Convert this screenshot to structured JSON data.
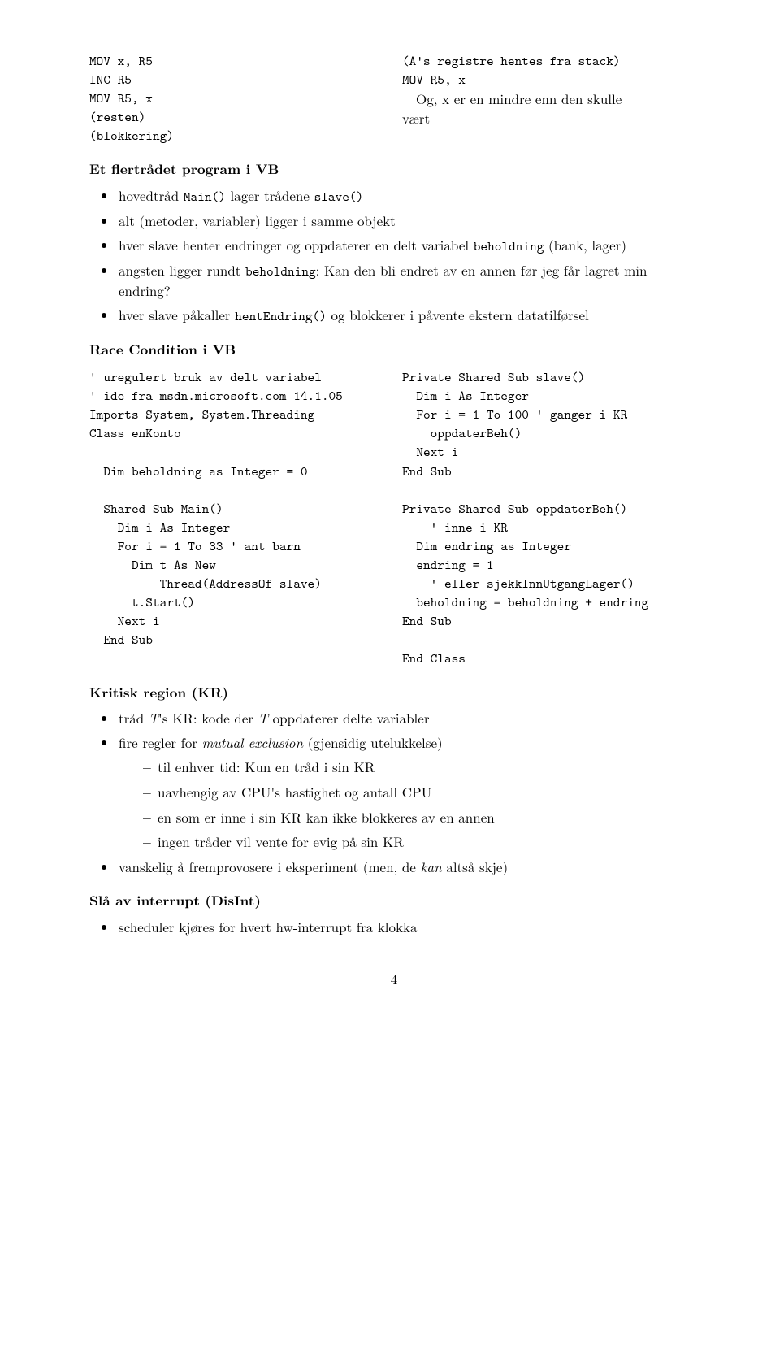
{
  "code1_left": "MOV x, R5\nINC R5\nMOV R5, x\n(resten)\n(blokkering)",
  "code1_right_l1": "(A's registre hentes fra stack)",
  "code1_right_l2": "MOV R5, x",
  "code1_right_prose_pre": "   Og, x er en mindre enn den skulle",
  "code1_right_prose_post": "vært",
  "sec1": "Et flertrådet program i VB",
  "b1_pre": "hovedtråd ",
  "b1_code1": "Main()",
  "b1_mid": " lager trådene ",
  "b1_code2": "slave()",
  "b2": "alt (metoder, variabler) ligger i samme objekt",
  "b3_pre": "hver slave henter endringer og oppdaterer en delt variabel ",
  "b3_code": "beholdning",
  "b3_post": " (bank, lager)",
  "b4_pre": "angsten ligger rundt ",
  "b4_code": "beholdning",
  "b4_post": ": Kan den bli endret av en annen før jeg får lagret min endring?",
  "b5_pre": "hver slave påkaller ",
  "b5_code": "hentEndring()",
  "b5_post": " og blokkerer i påvente ekstern datatilførsel",
  "sec2": "Race Condition i VB",
  "code2_left": "' uregulert bruk av delt variabel\n' ide fra msdn.microsoft.com 14.1.05\nImports System, System.Threading\nClass enKonto\n\n  Dim beholdning as Integer = 0\n\n  Shared Sub Main()\n    Dim i As Integer\n    For i = 1 To 33 ' ant barn\n      Dim t As New\n          Thread(AddressOf slave)\n      t.Start()\n    Next i\n  End Sub",
  "code2_right": "Private Shared Sub slave()\n  Dim i As Integer\n  For i = 1 To 100 ' ganger i KR\n    oppdaterBeh()\n  Next i\nEnd Sub\n\nPrivate Shared Sub oppdaterBeh()\n    ' inne i KR\n  Dim endring as Integer\n  endring = 1\n    ' eller sjekkInnUtgangLager()\n  beholdning = beholdning + endring\nEnd Sub\n\nEnd Class",
  "sec3": "Kritisk region (KR)",
  "c1_pre": "tråd ",
  "c1_T": "T",
  "c1_mid": "'s KR: kode der ",
  "c1_T2": "T",
  "c1_post": " oppdaterer delte variabler",
  "c2_pre": "fire regler for ",
  "c2_it": "mutual exclusion",
  "c2_post": " (gjensidig utelukkelse)",
  "d1": "til enhver tid: Kun en tråd i sin KR",
  "d2": "uavhengig av CPU's hastighet og antall CPU",
  "d3": "en som er inne i sin KR kan ikke blokkeres av en annen",
  "d4": "ingen tråder vil vente for evig på sin KR",
  "c3_pre": "vanskelig å fremprovosere i eksperiment (men, de ",
  "c3_it": "kan",
  "c3_post": " altså skje)",
  "sec4": "Slå av interrupt (DisInt)",
  "e1": "scheduler kjøres for hvert hw-interrupt fra klokka",
  "page": "4"
}
